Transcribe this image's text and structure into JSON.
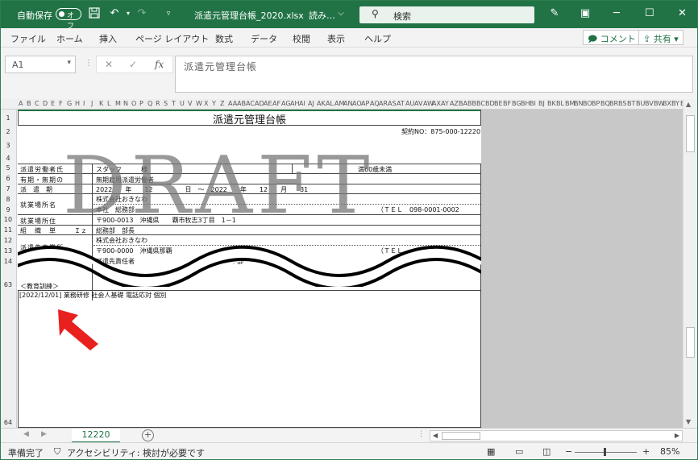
{
  "titlebar": {
    "autosave_label": "自動保存",
    "autosave_state": "オフ",
    "filename": "派遣元管理台帳_2020.xlsx",
    "mode": "読み…",
    "search_placeholder": "検索"
  },
  "ribbon": {
    "tabs": [
      "ファイル",
      "ホーム",
      "挿入",
      "ページ レイアウト",
      "数式",
      "データ",
      "校閲",
      "表示",
      "ヘルプ"
    ],
    "comment_label": "コメント",
    "share_label": "共有"
  },
  "formula_bar": {
    "cell_ref": "A1",
    "content": "派遣元管理台帳"
  },
  "columns": [
    "A",
    "B",
    "C",
    "D",
    "E",
    "F",
    "G",
    "H",
    "I",
    "J",
    "K",
    "L",
    "M",
    "N",
    "O",
    "P",
    "Q",
    "R",
    "S",
    "T",
    "U",
    "V",
    "W",
    "X",
    "Y",
    "Z",
    "AA",
    "AB",
    "AC",
    "AD",
    "AE",
    "AF",
    "AG",
    "AH",
    "AI",
    "AJ",
    "AK",
    "AL",
    "AM",
    "AN",
    "AO",
    "AP",
    "AQ",
    "AR",
    "AS",
    "AT",
    "AU",
    "AV",
    "AW",
    "AX",
    "AY",
    "AZ",
    "BA",
    "BB",
    "BC",
    "BD",
    "BE",
    "BF",
    "BG",
    "BH",
    "BI",
    "BJ",
    "BK",
    "BL",
    "BM",
    "BN",
    "BO",
    "BP",
    "BQ",
    "BR",
    "BS",
    "BT",
    "BU",
    "BV",
    "BW",
    "BX",
    "BY",
    "BZ"
  ],
  "rows": [
    "1",
    "2",
    "3",
    "4",
    "5",
    "6",
    "7",
    "8",
    "9",
    "10",
    "11",
    "12",
    "13",
    "14",
    "63",
    "64"
  ],
  "document": {
    "title": "派遣元管理台帳",
    "contract_no": "契約NO：875-000-12220",
    "labels": [
      "派遣労働者氏",
      "有期・無期の",
      "派　遣　期",
      "就業場所名",
      "就業場所住",
      "組　織　単",
      "派遣先事業所"
    ],
    "row5_value": "スタッフ　　　様",
    "row5_right": "満60歳未満",
    "row6_value": "無期雇用派遣労働者",
    "row7_value": "2022　　年　　12　　　　　日　～　2022　　年　　12　　月　　31",
    "row8_value": "株式会社おきなわ",
    "row9_value": "本社　総務部",
    "row9_tel": "（ＴＥＬ　098-0001-0002",
    "row10_value": "〒900-0013　沖縄県　　覇市牧志3丁目　1－1",
    "row11_unit": "Ｉｚ",
    "row11_value": "総務部　部長",
    "row12_value": "株式会社おきなわ",
    "row13_value": "〒900-0000　沖縄県那覇",
    "row13_tel": "（ＴＥＬ",
    "row14_value": "派遣先責任者",
    "row14_right": "本部",
    "section_label": "＜教育訓練＞",
    "training_entry": "[2022/12/01] 業務研修 社会人基礎 電話応対 個別",
    "watermark": "DRAFT"
  },
  "sheet_tab": "12220",
  "status": {
    "ready": "準備完了",
    "accessibility": "アクセシビリティ: 検討が必要です",
    "zoom": "85%"
  },
  "colors": {
    "accent": "#217346",
    "arrow": "#e8201e"
  }
}
